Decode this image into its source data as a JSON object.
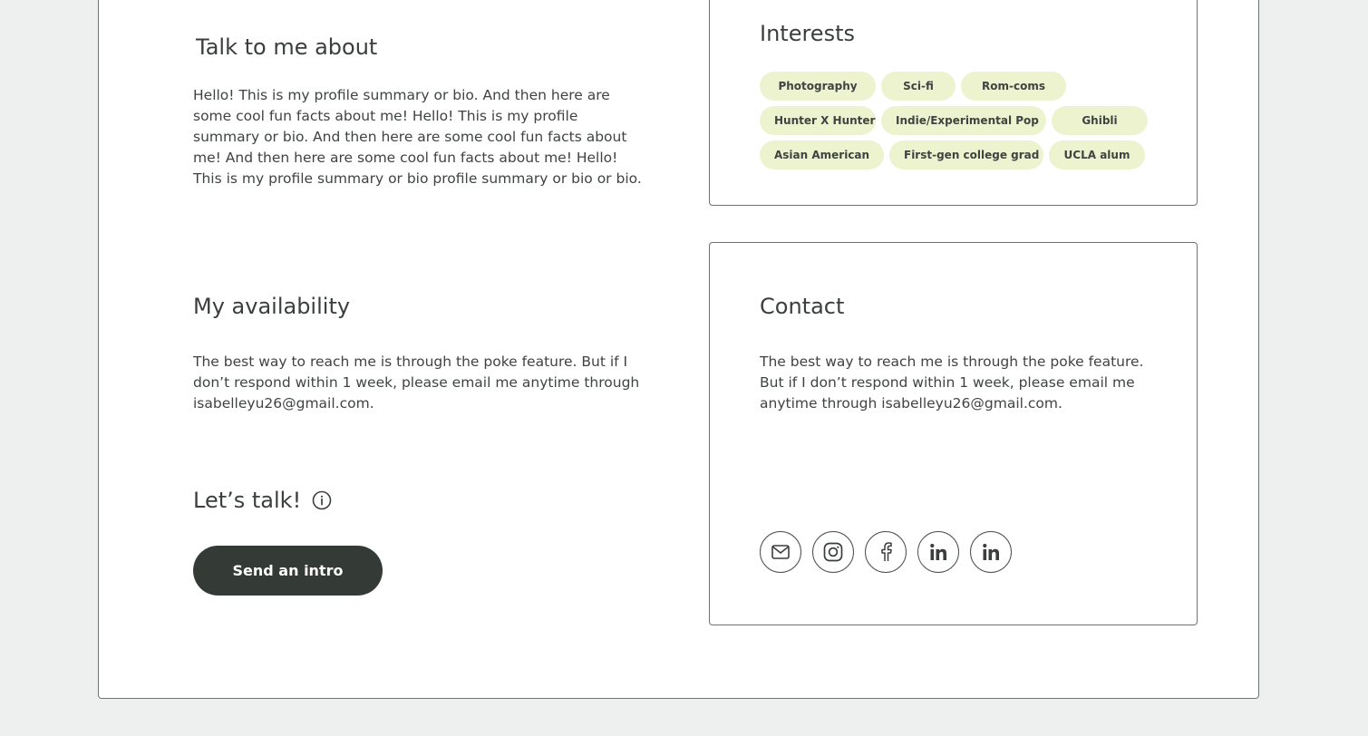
{
  "about": {
    "title": "Talk to me about",
    "bio": "Hello! This is my profile summary or bio. And then here are some cool fun facts about me! Hello! This is my profile summary or bio. And then here are some cool fun facts about me! And then here are some cool fun facts about me! Hello! This is my profile summary or bio profile summary or bio or bio."
  },
  "availability": {
    "title": "My availability",
    "text": "The best way to reach me is through the poke feature. But if I don’t respond within 1 week, please email me anytime through isabelleyu26@gmail.com."
  },
  "talk": {
    "title": "Let’s talk!",
    "info_icon": "info-circle-icon",
    "button_label": "Send an intro"
  },
  "interests": {
    "title": "Interests",
    "rows": [
      [
        "Photography",
        "Sci-fi",
        "Rom-coms"
      ],
      [
        "Hunter X Hunter",
        "Indie/Experimental Pop",
        "Ghibli"
      ],
      [
        "Asian American",
        "First-gen college grad",
        "UCLA alum"
      ]
    ]
  },
  "contact": {
    "title": "Contact",
    "text": "The best way to reach me is through the poke feature. But if I don’t respond within 1 week, please email me anytime through isabelleyu26@gmail.com.",
    "socials": [
      "mail-icon",
      "instagram-icon",
      "facebook-icon",
      "linkedin-icon",
      "linkedin-icon"
    ]
  },
  "colors": {
    "background": "#eef0ef",
    "card": "#ffffff",
    "chip": "#eef3cf",
    "button": "#343b37",
    "text": "#3a3f3c"
  }
}
